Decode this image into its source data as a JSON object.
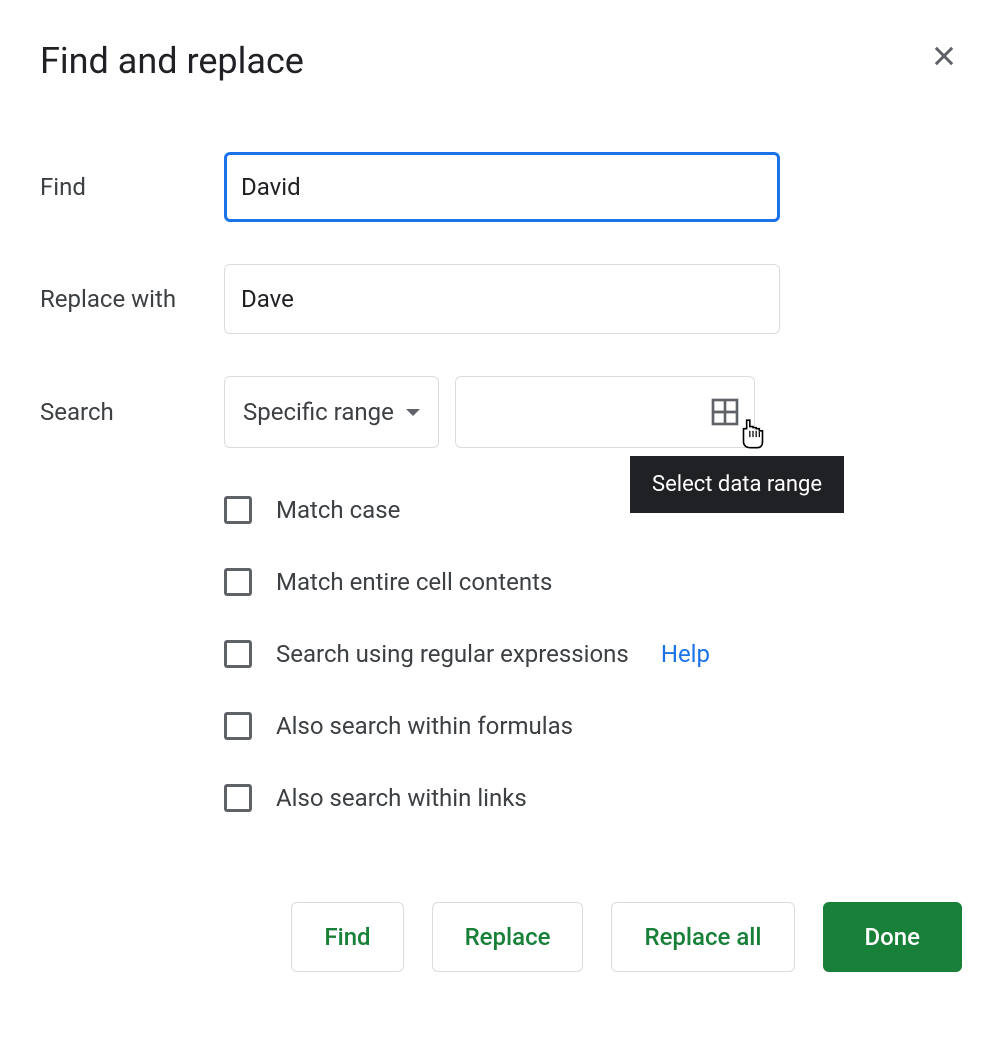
{
  "dialog": {
    "title": "Find and replace"
  },
  "fields": {
    "find_label": "Find",
    "find_value": "David",
    "replace_label": "Replace with",
    "replace_value": "Dave",
    "search_label": "Search",
    "search_dropdown": "Specific range",
    "range_value": ""
  },
  "options": {
    "match_case": "Match case",
    "match_entire": "Match entire cell contents",
    "regex": "Search using regular expressions",
    "regex_help": "Help",
    "formulas": "Also search within formulas",
    "links": "Also search within links"
  },
  "buttons": {
    "find": "Find",
    "replace": "Replace",
    "replace_all": "Replace all",
    "done": "Done"
  },
  "tooltip": {
    "select_range": "Select data range"
  }
}
